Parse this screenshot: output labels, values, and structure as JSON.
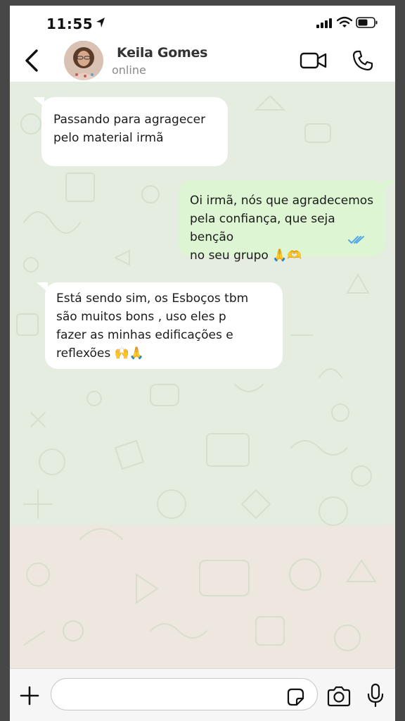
{
  "status_bar": {
    "time": "11:55"
  },
  "header": {
    "contact_name": "Keila Gomes",
    "contact_status": "online"
  },
  "messages": [
    {
      "direction": "incoming",
      "text": "Passando para agragecer\npelo material irmã"
    },
    {
      "direction": "outgoing",
      "text": "Oi irmã, nós que agradecemos\npela confiança, que seja benção\nno seu grupo 🙏🫶",
      "status": "read"
    },
    {
      "direction": "incoming",
      "text": "Está sendo sim, os Esboços tbm\nsão muitos bons , uso eles p\nfazer as minhas edificações e\nreflexões 🙌🙏"
    }
  ],
  "input": {
    "placeholder": ""
  },
  "colors": {
    "outgoing_bubble": "#ddf5d2",
    "incoming_bubble": "#ffffff",
    "read_check": "#4fa6e8",
    "chat_background": "#e5ece0"
  },
  "icons": {
    "back": "chevron-left-icon",
    "video": "video-camera-icon",
    "call": "phone-icon",
    "add": "plus-icon",
    "sticker": "sticker-icon",
    "camera": "camera-icon",
    "mic": "microphone-icon"
  }
}
